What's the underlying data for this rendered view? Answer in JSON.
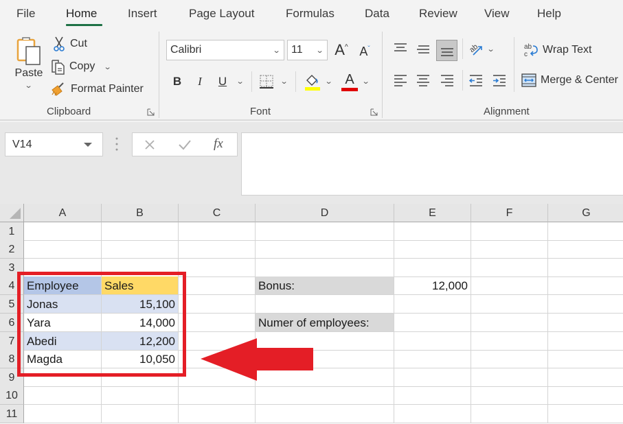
{
  "ribbon_tabs": [
    {
      "label": "File",
      "active": false
    },
    {
      "label": "Home",
      "active": true
    },
    {
      "label": "Insert",
      "active": false
    },
    {
      "label": "Page Layout",
      "active": false
    },
    {
      "label": "Formulas",
      "active": false
    },
    {
      "label": "Data",
      "active": false
    },
    {
      "label": "Review",
      "active": false
    },
    {
      "label": "View",
      "active": false
    },
    {
      "label": "Help",
      "active": false
    }
  ],
  "accent_color": "#1e7145",
  "clipboard": {
    "group_label": "Clipboard",
    "paste_label": "Paste",
    "cut_label": "Cut",
    "copy_label": "Copy",
    "format_painter_label": "Format Painter"
  },
  "font": {
    "group_label": "Font",
    "font_name": "Calibri",
    "font_size": "11",
    "bold_label": "B",
    "italic_label": "I",
    "underline_label": "U",
    "font_color_label": "A",
    "highlight_color": "#ffff00",
    "font_color": "#e00000"
  },
  "alignment": {
    "group_label": "Alignment",
    "wrap_text_label": "Wrap Text",
    "merge_center_label": "Merge & Center"
  },
  "formula_bar": {
    "name_box": "V14",
    "formula": "",
    "fx_label": "fx"
  },
  "columns": [
    "A",
    "B",
    "C",
    "D",
    "E",
    "F",
    "G"
  ],
  "rows": [
    "1",
    "2",
    "3",
    "4",
    "5",
    "6",
    "7",
    "8",
    "9",
    "10",
    "11"
  ],
  "table": {
    "headers": [
      "Employee",
      "Sales"
    ],
    "rows": [
      {
        "employee": "Jonas",
        "sales": "15,100"
      },
      {
        "employee": "Yara",
        "sales": "14,000"
      },
      {
        "employee": "Abedi",
        "sales": "12,200"
      },
      {
        "employee": "Magda",
        "sales": "10,050"
      }
    ],
    "header_color_a": "#b4c6e7",
    "header_color_b": "#ffd966",
    "band_color": "#d9e1f2"
  },
  "side_cells": {
    "bonus_label": "Bonus:",
    "bonus_value": "12,000",
    "employees_label": "Numer of employees:",
    "employees_value": "",
    "label_fill": "#d9d9d9"
  },
  "annotation": {
    "highlight_color": "#e41e26",
    "arrow_direction": "left"
  }
}
